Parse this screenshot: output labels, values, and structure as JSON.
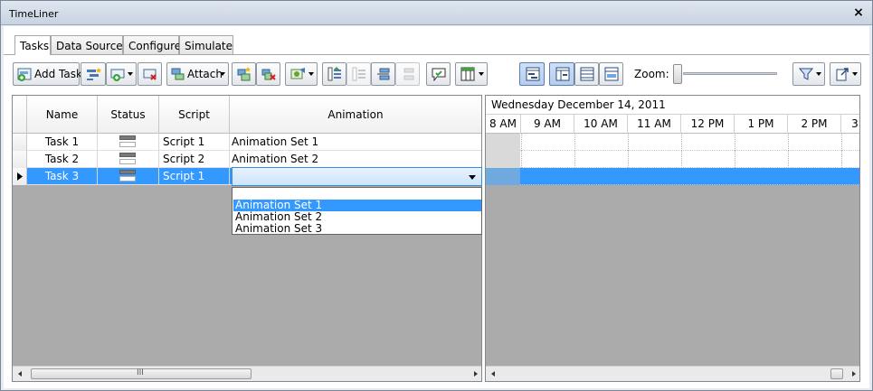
{
  "window": {
    "title": "TimeLiner"
  },
  "tabs": [
    {
      "label": "Tasks"
    },
    {
      "label": "Data Sources"
    },
    {
      "label": "Configure"
    },
    {
      "label": "Simulate"
    }
  ],
  "toolbar": {
    "add_task_label": "Add Task",
    "attach_label": "Attach",
    "zoom_label": "Zoom:",
    "zoom_level": 0.0
  },
  "grid": {
    "columns": [
      "Name",
      "Status",
      "Script",
      "Animation"
    ],
    "rows": [
      {
        "name": "Task 1",
        "script": "Script 1",
        "animation": "Animation Set 1"
      },
      {
        "name": "Task 2",
        "script": "Script 2",
        "animation": "Animation Set 2"
      },
      {
        "name": "Task 3",
        "script": "Script 1",
        "animation": ""
      }
    ],
    "selected_row": 2,
    "dropdown_options": [
      "Animation Set 1",
      "Animation Set 2",
      "Animation Set 3"
    ],
    "dropdown_highlighted": "Animation Set 1",
    "scroll_grip": "III"
  },
  "gantt": {
    "date": "Wednesday December 14, 2011",
    "hours": [
      "8 AM",
      "9 AM",
      "10 AM",
      "11 AM",
      "12 PM",
      "1 PM",
      "2 PM",
      "3"
    ]
  },
  "colors": {
    "selection": "#3399ff",
    "grid_background": "#ababab"
  }
}
